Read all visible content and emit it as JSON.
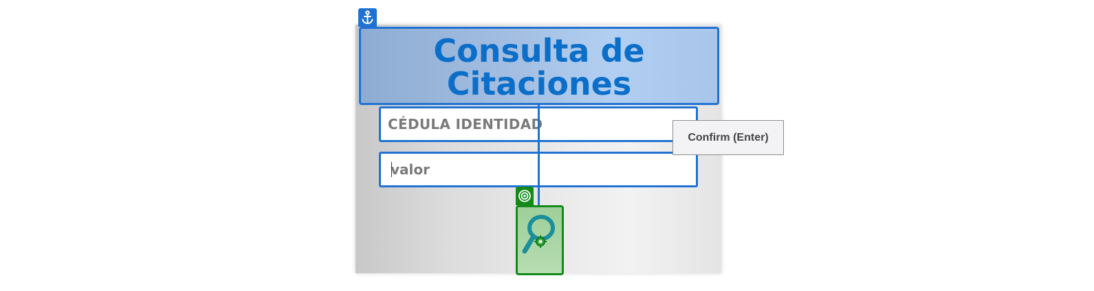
{
  "app": {
    "title": "Consulta de\nCitaciones"
  },
  "form": {
    "id_label": "CÉDULA IDENTIDAD",
    "value_placeholder": "valor",
    "value_current": ""
  },
  "tooltip": {
    "text": "Confirm (Enter)"
  },
  "icons": {
    "anchor": "anchor-icon",
    "target": "target-icon",
    "search": "magnifier-search-icon"
  },
  "colors": {
    "selection_blue": "#1f72d2",
    "title_text": "#0b6ec9",
    "target_green": "#138a1a",
    "label_gray": "#7a7a7a"
  }
}
